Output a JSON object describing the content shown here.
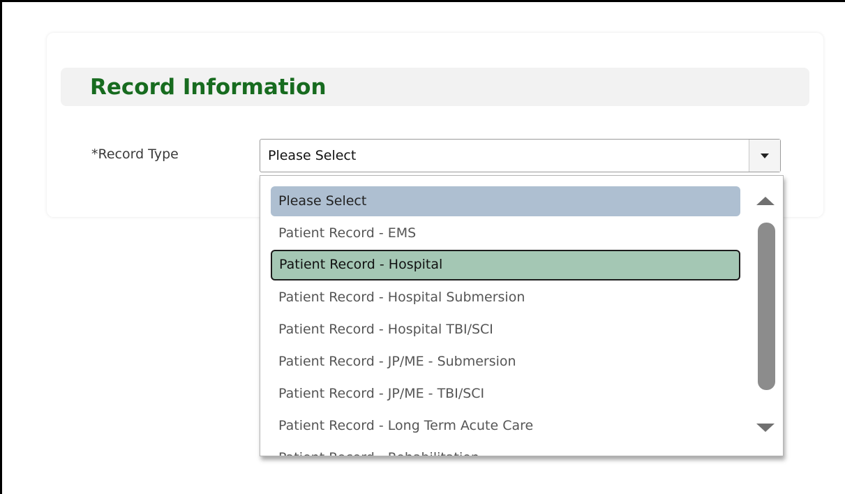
{
  "section": {
    "title": "Record Information"
  },
  "record_type": {
    "label": "*Record Type",
    "selected_value": "Please Select",
    "options": [
      "Please Select",
      "Patient Record - EMS",
      "Patient Record - Hospital",
      "Patient Record - Hospital Submersion",
      "Patient Record - Hospital TBI/SCI",
      "Patient Record - JP/ME - Submersion",
      "Patient Record - JP/ME - TBI/SCI",
      "Patient Record - Long Term Acute Care",
      "Patient Record - Rehabilitation"
    ]
  },
  "colors": {
    "title": "#176b1f",
    "selected_option_bg": "#aebfd1",
    "hover_option_bg": "#a4c7b4"
  }
}
